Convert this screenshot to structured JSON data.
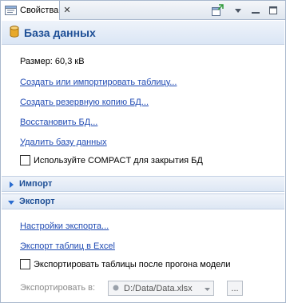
{
  "tab": {
    "label": "Свойства",
    "icon": "properties-icon"
  },
  "toolbar": {
    "buttons": [
      "new-window-icon",
      "view-menu-icon",
      "minimize-icon",
      "maximize-icon"
    ]
  },
  "header": {
    "title": "База данных",
    "icon": "database-icon"
  },
  "database": {
    "size": "Размер: 60,3 кВ",
    "create_import": "Создать или импортировать таблицу...",
    "backup": "Создать резервную копию БД...",
    "restore": "Восстановить БД...",
    "delete": "Удалить базу данных",
    "compact": {
      "label": "Используйте COMPACT для закрытия БД",
      "checked": false
    }
  },
  "import_section": {
    "label": "Импорт",
    "expanded": false
  },
  "export_section": {
    "label": "Экспорт",
    "expanded": true,
    "settings": "Настройки экспорта...",
    "export_excel": "Экспорт таблиц в Excel",
    "export_after_run": {
      "label": "Экспортировать таблицы после прогона модели",
      "checked": false
    },
    "export_to_label": "Экспортировать в:",
    "export_to_value": "D:/Data/Data.xlsx",
    "browse_label": "..."
  },
  "colors": {
    "header_text": "#1e4f96",
    "link": "#1f4ab3",
    "border": "#a9b8cd"
  }
}
